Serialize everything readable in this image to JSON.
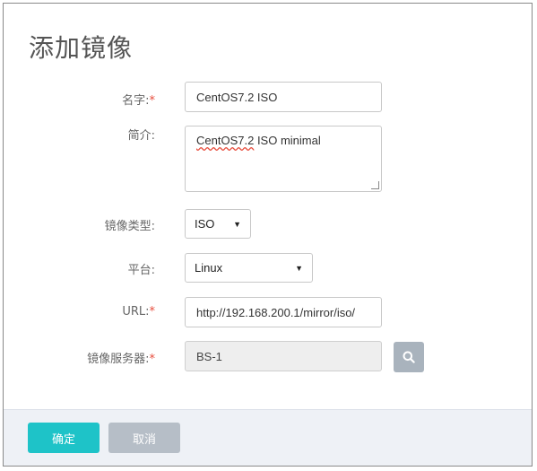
{
  "dialog": {
    "title": "添加镜像"
  },
  "form": {
    "name": {
      "label": "名字:",
      "required_mark": "*",
      "value": "CentOS7.2 ISO"
    },
    "description": {
      "label": "简介:",
      "value_word1": "CentOS7.2",
      "value_rest": " ISO minimal"
    },
    "image_type": {
      "label": "镜像类型:",
      "selected": "ISO"
    },
    "platform": {
      "label": "平台:",
      "selected": "Linux"
    },
    "url": {
      "label": "URL:",
      "required_mark": "*",
      "value": "http://192.168.200.1/mirror/iso/"
    },
    "backup_storage": {
      "label": "镜像服务器:",
      "required_mark": "*",
      "value": "BS-1",
      "search_icon": "search-icon"
    }
  },
  "footer": {
    "ok_label": "确定",
    "cancel_label": "取消"
  },
  "colors": {
    "primary": "#1ec3c8",
    "secondary": "#b6bec7",
    "required": "#e74c3c"
  }
}
